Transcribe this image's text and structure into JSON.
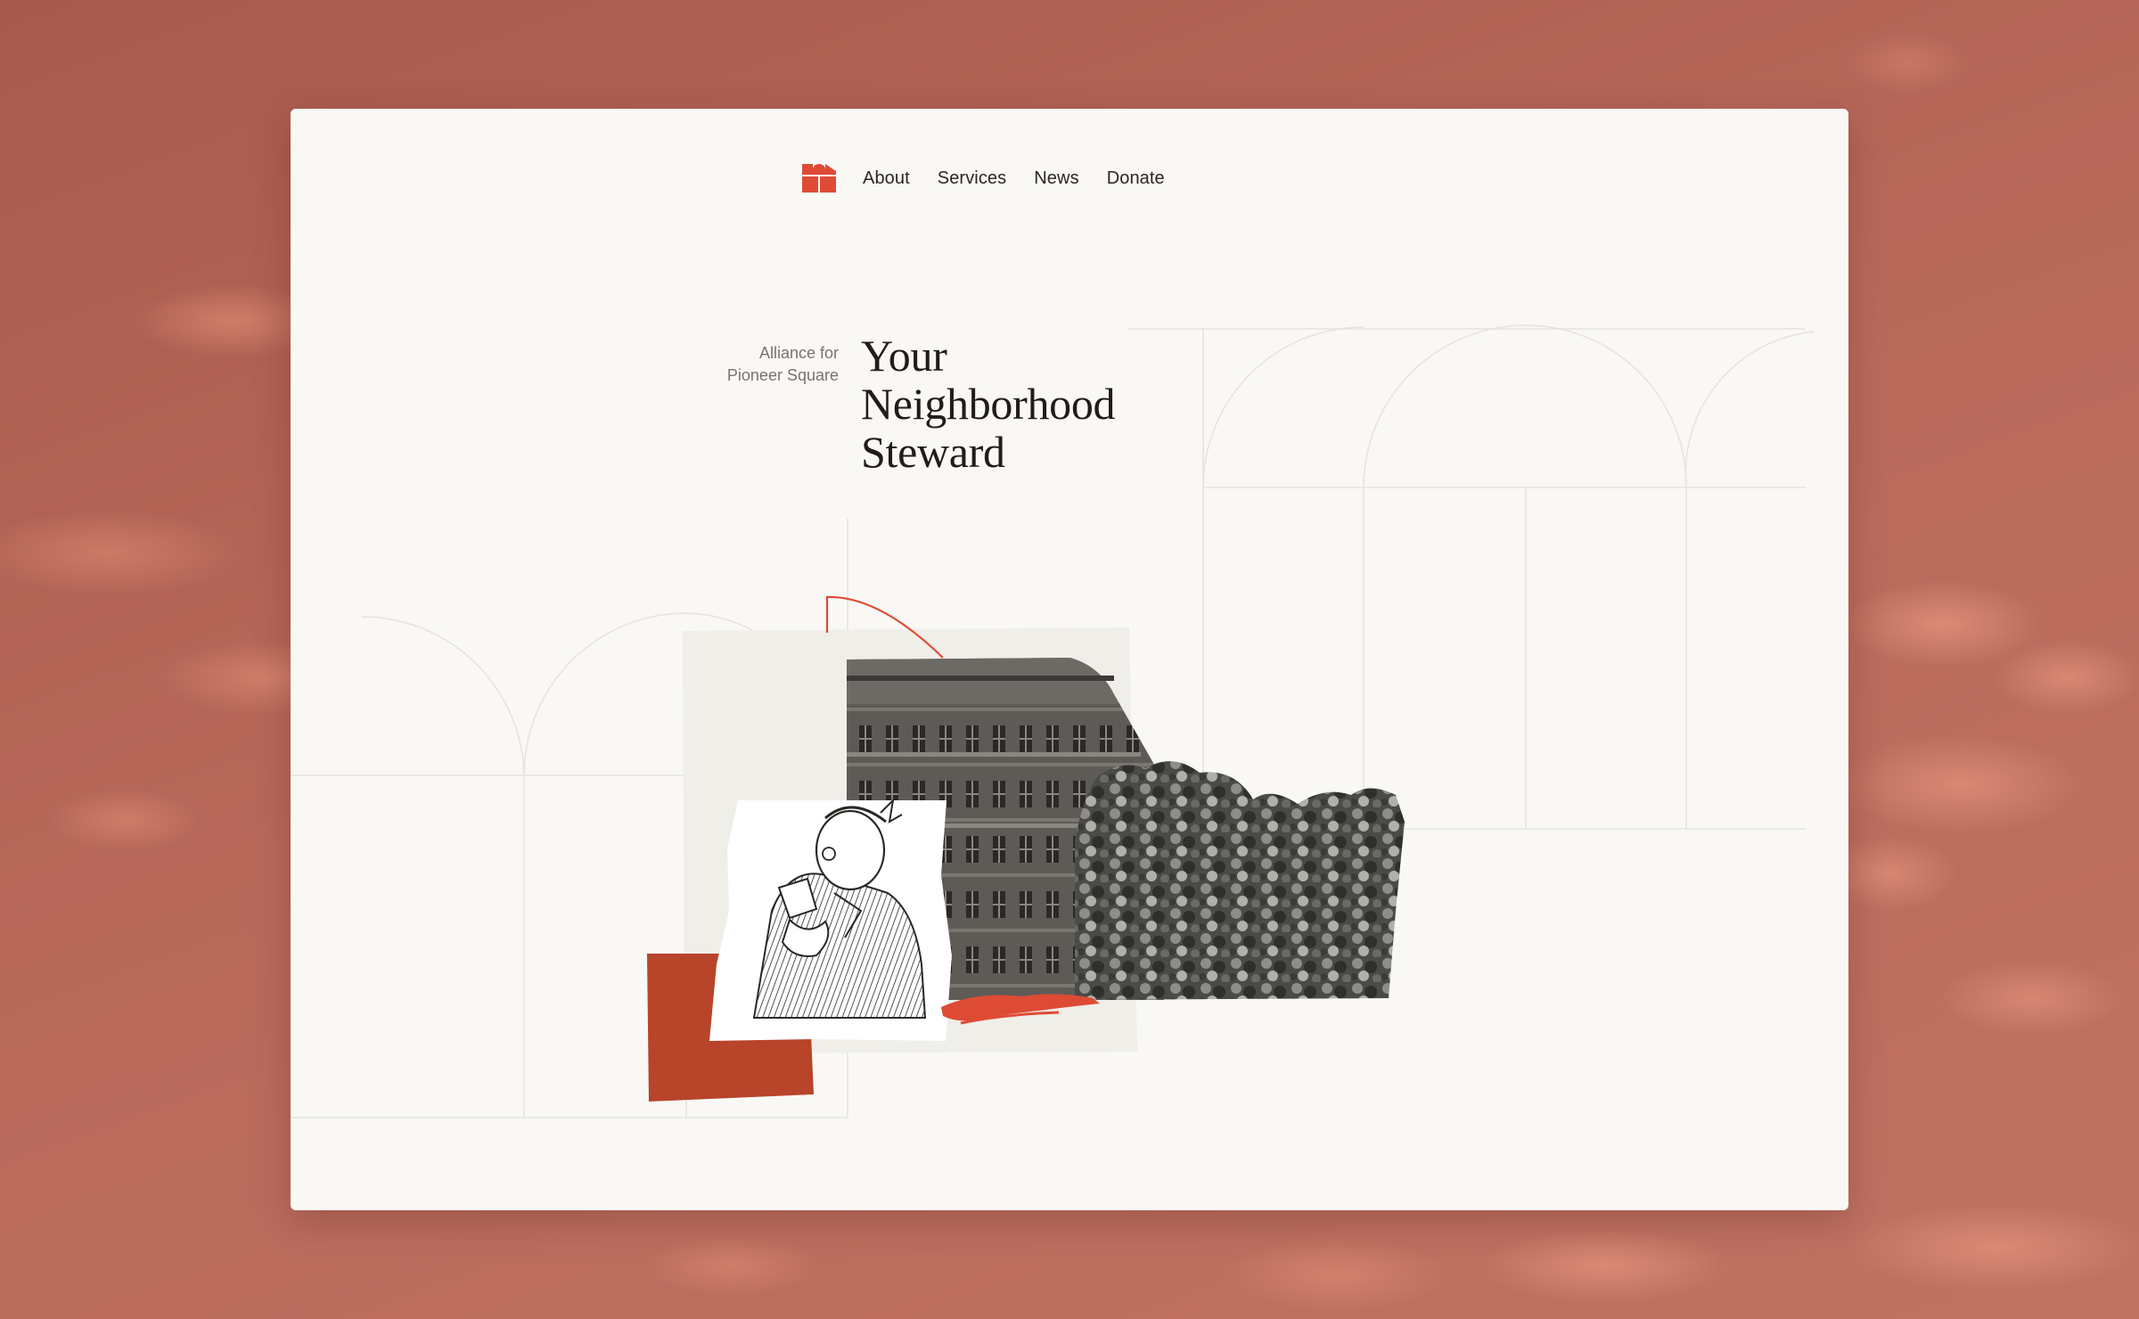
{
  "brand": {
    "logo_icon": "arch-building-icon",
    "accent_color": "#de4b35",
    "deep_accent_color": "#b8442a"
  },
  "nav": {
    "items": [
      {
        "label": "About"
      },
      {
        "label": "Services"
      },
      {
        "label": "News"
      },
      {
        "label": "Donate"
      }
    ]
  },
  "hero": {
    "org_line_1": "Alliance for",
    "org_line_2": "Pioneer Square",
    "headline_line_1": "Your",
    "headline_line_2": "Neighborhood",
    "headline_line_3": "Steward"
  },
  "collage": {
    "items": [
      "building-photo",
      "trees-photo",
      "man-reading-illustration",
      "red-paper-block",
      "red-brush-stroke",
      "red-arch-outline"
    ]
  },
  "colors": {
    "page_background": "#f9f8f5",
    "backdrop": "#b56453",
    "text": "#1f1c19",
    "muted_text": "#7a736c"
  }
}
